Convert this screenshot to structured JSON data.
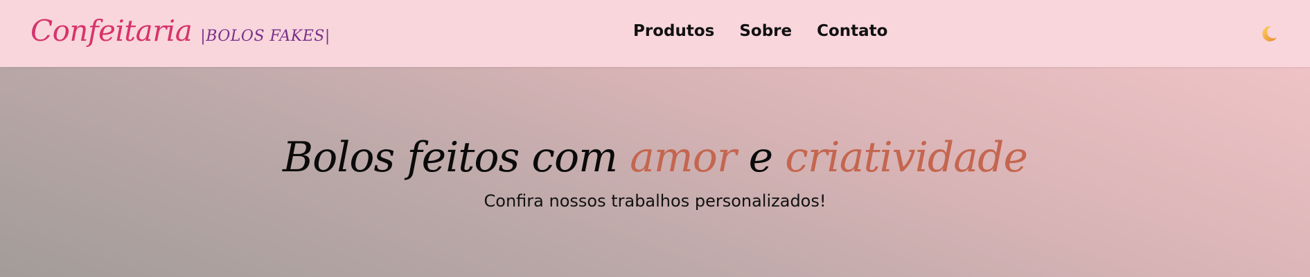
{
  "header": {
    "brand_name": "Confeitaria",
    "brand_tag": "|BOLOS FAKES|",
    "nav": [
      {
        "label": "Produtos"
      },
      {
        "label": "Sobre"
      },
      {
        "label": "Contato"
      }
    ],
    "theme_toggle_icon": "crescent-moon-icon"
  },
  "hero": {
    "title_part1": "Bolos feitos com ",
    "title_accent1": "amor",
    "title_part2": " e ",
    "title_accent2": "criatividade",
    "subtitle": "Confira nossos trabalhos personalizados!"
  },
  "colors": {
    "navbar_bg": "#f8d6dc",
    "brand": "#d7336c",
    "brand_tag": "#7a2f8a",
    "accent": "#c4664f",
    "moon": "#f2a93b"
  }
}
